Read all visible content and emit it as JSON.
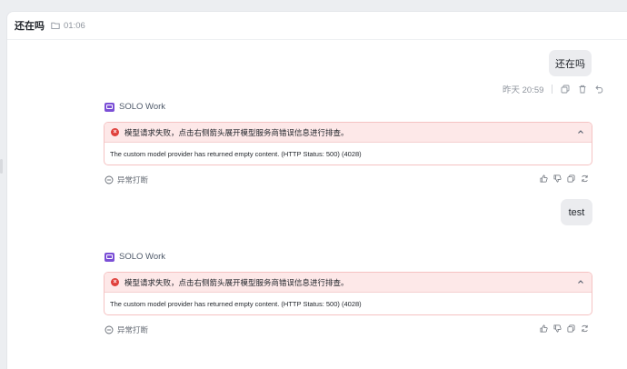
{
  "header": {
    "title": "还在吗",
    "folder_icon": "folder-icon",
    "time": "01:06"
  },
  "messages": [
    {
      "user_text": "还在吗",
      "meta": {
        "timestamp": "昨天 20:59",
        "icons": [
          "copy-icon",
          "trash-icon",
          "undo-icon"
        ]
      }
    },
    {
      "agent": "SOLO Work",
      "error_title": "模型请求失败，点击右侧箭头展开模型服务商错误信息进行排查。",
      "error_detail": "The custom model provider has returned empty content. (HTTP Status: 500) (4028)",
      "status": "异常打断",
      "actions": [
        "thumbs-up-icon",
        "thumbs-down-icon",
        "copy-icon",
        "refresh-icon"
      ]
    },
    {
      "user_text": "test"
    },
    {
      "agent": "SOLO Work",
      "error_title": "模型请求失败，点击右侧箭头展开模型服务商错误信息进行排查。",
      "error_detail": "The custom model provider has returned empty content. (HTTP Status: 500) (4028)",
      "status": "异常打断",
      "actions": [
        "thumbs-up-icon",
        "thumbs-down-icon",
        "copy-icon",
        "refresh-icon"
      ]
    }
  ],
  "colors": {
    "error_bg": "#fde8e8",
    "error_border": "#f5c2c2",
    "error_icon": "#e0403c",
    "agent_logo": "#7b4fd6",
    "bubble_bg": "#ebecef"
  }
}
